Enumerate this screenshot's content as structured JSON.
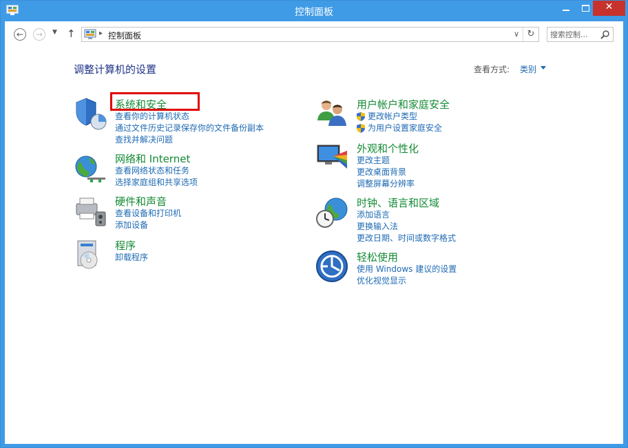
{
  "window": {
    "title": "控制面板",
    "close_glyph": "✕",
    "icons": {
      "app": "control-panel-icon",
      "minimize": "minimize-icon",
      "maximize": "maximize-icon",
      "close": "close-icon"
    }
  },
  "nav": {
    "back_glyph": "←",
    "forward_glyph": "→",
    "recent_glyph": "▼",
    "up_glyph": "↑",
    "address_arrow_glyph": "▸",
    "address_dropdown_glyph": "∨",
    "refresh_glyph": "↻",
    "breadcrumb": "控制面板",
    "search_placeholder": "搜索控制... "
  },
  "main": {
    "heading": "调整计算机的设置",
    "view_by_label": "查看方式:",
    "view_by_value": "类别"
  },
  "categories": [
    {
      "title": "系统和安全",
      "icon": "system-security-icon",
      "links": [
        {
          "label": "查看你的计算机状态"
        },
        {
          "label": "通过文件历史记录保存你的文件备份副本"
        },
        {
          "label": "查找并解决问题"
        }
      ]
    },
    {
      "title": "网络和 Internet",
      "icon": "network-internet-icon",
      "links": [
        {
          "label": "查看网络状态和任务"
        },
        {
          "label": "选择家庭组和共享选项"
        }
      ]
    },
    {
      "title": "硬件和声音",
      "icon": "hardware-sound-icon",
      "links": [
        {
          "label": "查看设备和打印机"
        },
        {
          "label": "添加设备"
        }
      ]
    },
    {
      "title": "程序",
      "icon": "programs-icon",
      "links": [
        {
          "label": "卸载程序"
        }
      ]
    },
    {
      "title": "用户帐户和家庭安全",
      "icon": "user-accounts-icon",
      "links": [
        {
          "label": "更改帐户类型",
          "shield": true
        },
        {
          "label": "为用户设置家庭安全",
          "shield": true
        }
      ]
    },
    {
      "title": "外观和个性化",
      "icon": "appearance-icon",
      "links": [
        {
          "label": "更改主题"
        },
        {
          "label": "更改桌面背景"
        },
        {
          "label": "调整屏幕分辨率"
        }
      ]
    },
    {
      "title": "时钟、语言和区域",
      "icon": "clock-language-region-icon",
      "links": [
        {
          "label": "添加语言"
        },
        {
          "label": "更换输入法"
        },
        {
          "label": "更改日期、时间或数字格式"
        }
      ]
    },
    {
      "title": "轻松使用",
      "icon": "ease-of-access-icon",
      "links": [
        {
          "label": "使用 Windows 建议的设置"
        },
        {
          "label": "优化视觉显示"
        }
      ]
    }
  ],
  "colors": {
    "titlebar": "#3f9be6",
    "close_button": "#c7322d",
    "category_title": "#138a34",
    "link": "#1e6ab4",
    "heading": "#1e3287",
    "highlight": "#e00000"
  }
}
